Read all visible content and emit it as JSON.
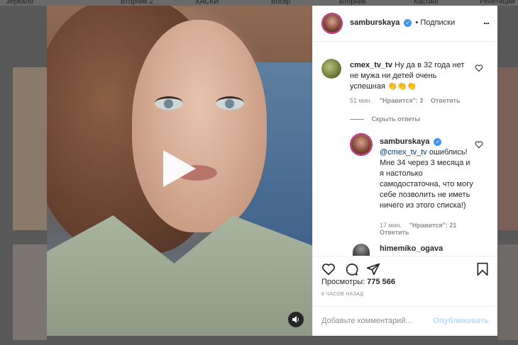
{
  "background_tabs": [
    "Зеркало",
    "Вторник 2",
    "ХАСКИ",
    "Воскр",
    "Вторник",
    "Кастинг",
    "Репетиции"
  ],
  "post": {
    "author": "samburskaya",
    "follow_separator": "•",
    "follow_label": "Подписки",
    "more_label": "...",
    "views_label": "Просмотры:",
    "views_count": "775 566",
    "time_ago": "8 ЧАСОВ НАЗАД",
    "add_comment_placeholder": "Добавьте комментарий...",
    "publish_label": "Опубликовать"
  },
  "comments": [
    {
      "username": "cmex_tv_tv",
      "text": "Ну да в 32 года нет не мужа ни детей очень успешная 👏👏👏",
      "time": "51 мин.",
      "likes": "\"Нравится\": 3",
      "reply_label": "Ответить",
      "hide_replies_label": "Скрыть ответы"
    },
    {
      "username": "samburskaya",
      "mention": "@cmex_tv_tv",
      "text": "ошиблись! Мне 34 через 3 месяца и я настолько самодостаточна, что могу себе позволить не иметь ничего из этого списка!)",
      "time": "17 мин.",
      "likes": "\"Нравится\": 21",
      "reply_label": "Ответить"
    },
    {
      "username": "himemiko_ogava"
    }
  ],
  "colors": {
    "verified": "#3897f0",
    "link": "#00376b",
    "publish_disabled": "#b3dbff"
  },
  "icons": [
    "heart-icon",
    "comment-icon",
    "share-icon",
    "bookmark-icon",
    "sound-icon",
    "verified-icon",
    "more-icon",
    "play-icon"
  ]
}
